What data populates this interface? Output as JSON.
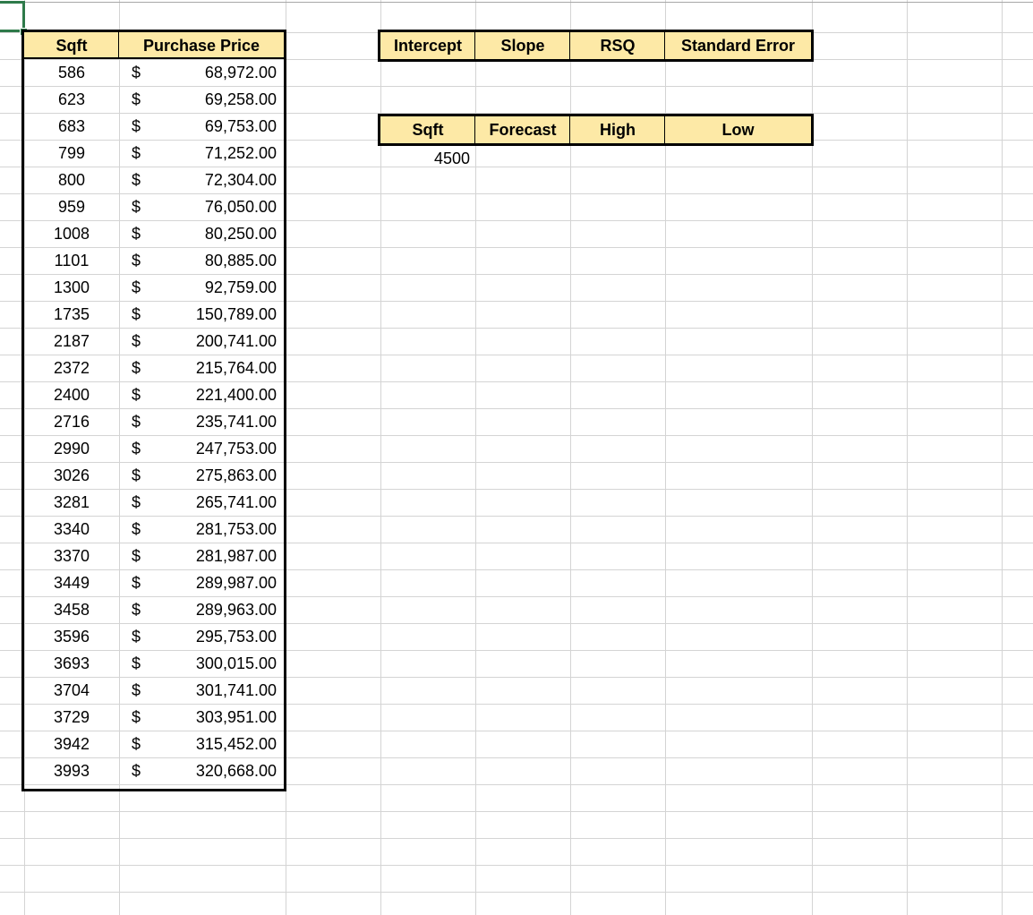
{
  "sheet": {
    "data_table": {
      "headers": {
        "sqft": "Sqft",
        "price": "Purchase Price"
      },
      "currency_symbol": "$",
      "rows": [
        {
          "sqft": "586",
          "price": "68,972.00"
        },
        {
          "sqft": "623",
          "price": "69,258.00"
        },
        {
          "sqft": "683",
          "price": "69,753.00"
        },
        {
          "sqft": "799",
          "price": "71,252.00"
        },
        {
          "sqft": "800",
          "price": "72,304.00"
        },
        {
          "sqft": "959",
          "price": "76,050.00"
        },
        {
          "sqft": "1008",
          "price": "80,250.00"
        },
        {
          "sqft": "1101",
          "price": "80,885.00"
        },
        {
          "sqft": "1300",
          "price": "92,759.00"
        },
        {
          "sqft": "1735",
          "price": "150,789.00"
        },
        {
          "sqft": "2187",
          "price": "200,741.00"
        },
        {
          "sqft": "2372",
          "price": "215,764.00"
        },
        {
          "sqft": "2400",
          "price": "221,400.00"
        },
        {
          "sqft": "2716",
          "price": "235,741.00"
        },
        {
          "sqft": "2990",
          "price": "247,753.00"
        },
        {
          "sqft": "3026",
          "price": "275,863.00"
        },
        {
          "sqft": "3281",
          "price": "265,741.00"
        },
        {
          "sqft": "3340",
          "price": "281,753.00"
        },
        {
          "sqft": "3370",
          "price": "281,987.00"
        },
        {
          "sqft": "3449",
          "price": "289,987.00"
        },
        {
          "sqft": "3458",
          "price": "289,963.00"
        },
        {
          "sqft": "3596",
          "price": "295,753.00"
        },
        {
          "sqft": "3693",
          "price": "300,015.00"
        },
        {
          "sqft": "3704",
          "price": "301,741.00"
        },
        {
          "sqft": "3729",
          "price": "303,951.00"
        },
        {
          "sqft": "3942",
          "price": "315,452.00"
        },
        {
          "sqft": "3993",
          "price": "320,668.00"
        }
      ]
    },
    "stats_table": {
      "headers": [
        "Intercept",
        "Slope",
        "RSQ",
        "Standard Error"
      ]
    },
    "forecast_table": {
      "headers": [
        "Sqft",
        "Forecast",
        "High",
        "Low"
      ],
      "sqft_value": "4500"
    },
    "colors": {
      "header_fill": "#fde9a6",
      "gridline": "#d4d4d4",
      "selection": "#2e7a4a",
      "border": "#000000"
    }
  }
}
